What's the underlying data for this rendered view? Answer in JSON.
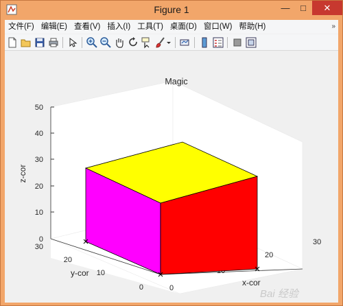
{
  "window": {
    "title": "Figure 1",
    "icon": "matlab-figure-icon",
    "controls": {
      "minimize": "—",
      "maximize": "□",
      "close": "✕"
    },
    "title_bar_color": "#f2a66a",
    "close_color": "#c7382f"
  },
  "menu": {
    "items": [
      "文件(F)",
      "编辑(E)",
      "查看(V)",
      "插入(I)",
      "工具(T)",
      "桌面(D)",
      "窗口(W)",
      "帮助(H)"
    ],
    "overflow": "»"
  },
  "toolbar": {
    "buttons": [
      "new-figure-icon",
      "open-file-icon",
      "save-icon",
      "print-icon",
      "select-arrow-icon",
      "zoom-in-icon",
      "zoom-out-icon",
      "pan-hand-icon",
      "rotate-3d-icon",
      "data-cursor-icon",
      "brush-icon",
      "brush-dropdown-icon",
      "link-plot-icon",
      "colorbar-icon",
      "legend-icon",
      "hide-plot-tools-icon",
      "show-plot-tools-icon"
    ]
  },
  "axes": {
    "title": "Magic",
    "xlabel": "x-cor",
    "ylabel": "y-cor",
    "zlabel": "z-cor",
    "z_ticks": [
      "0",
      "10",
      "20",
      "30",
      "40",
      "50"
    ],
    "y_ticks": [
      "0",
      "10",
      "20",
      "30"
    ],
    "x_ticks": [
      "0",
      "10",
      "20",
      "30"
    ]
  },
  "cube": {
    "top_color": "#ffff00",
    "left_color": "#ff00ff",
    "front_color": "#ff0000"
  },
  "watermark": {
    "text": "Bai 经验"
  }
}
